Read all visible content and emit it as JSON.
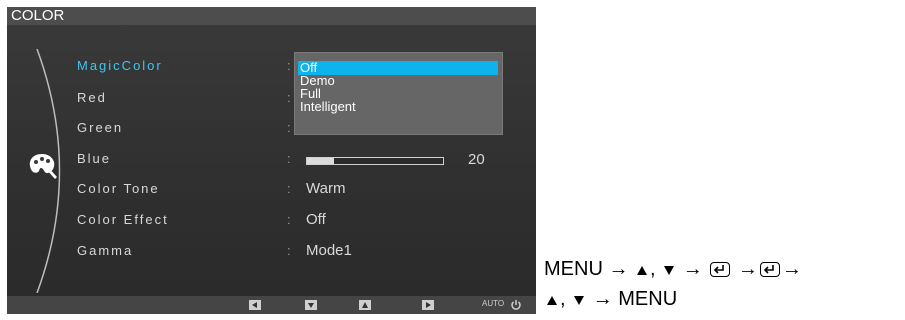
{
  "osd": {
    "title": "COLOR",
    "icon": "palette-icon",
    "menu": [
      {
        "label": "MagicColor",
        "value": "",
        "active": true
      },
      {
        "label": "Red",
        "value": ""
      },
      {
        "label": "Green",
        "value": ""
      },
      {
        "label": "Blue",
        "value": "20",
        "level": 0.2
      },
      {
        "label": "Color Tone",
        "value": "Warm"
      },
      {
        "label": "Color Effect",
        "value": "Off"
      },
      {
        "label": "Gamma",
        "value": "Mode1"
      }
    ],
    "dropdown": {
      "options": [
        "Off",
        "Demo",
        "Full",
        "Intelligent"
      ],
      "selected": "Off"
    },
    "bottom_buttons": [
      "left-arrow-icon",
      "down-arrow-icon",
      "up-arrow-icon",
      "right-arrow-icon",
      "AUTO",
      "power-icon"
    ],
    "auto_label": "AUTO",
    "colors": {
      "highlight": "#0db3ea",
      "active_label": "#3ec6f2",
      "panel": "#333333"
    }
  },
  "instructions": {
    "line1_start": "MENU →",
    "comma": ",",
    "arrow": "→",
    "line1_end": "→",
    "line2_end": "→ MENU",
    "keys": [
      "up-triangle-icon",
      "down-triangle-icon",
      "enter-key-icon",
      "enter-key-icon",
      "up-triangle-icon",
      "down-triangle-icon"
    ]
  }
}
